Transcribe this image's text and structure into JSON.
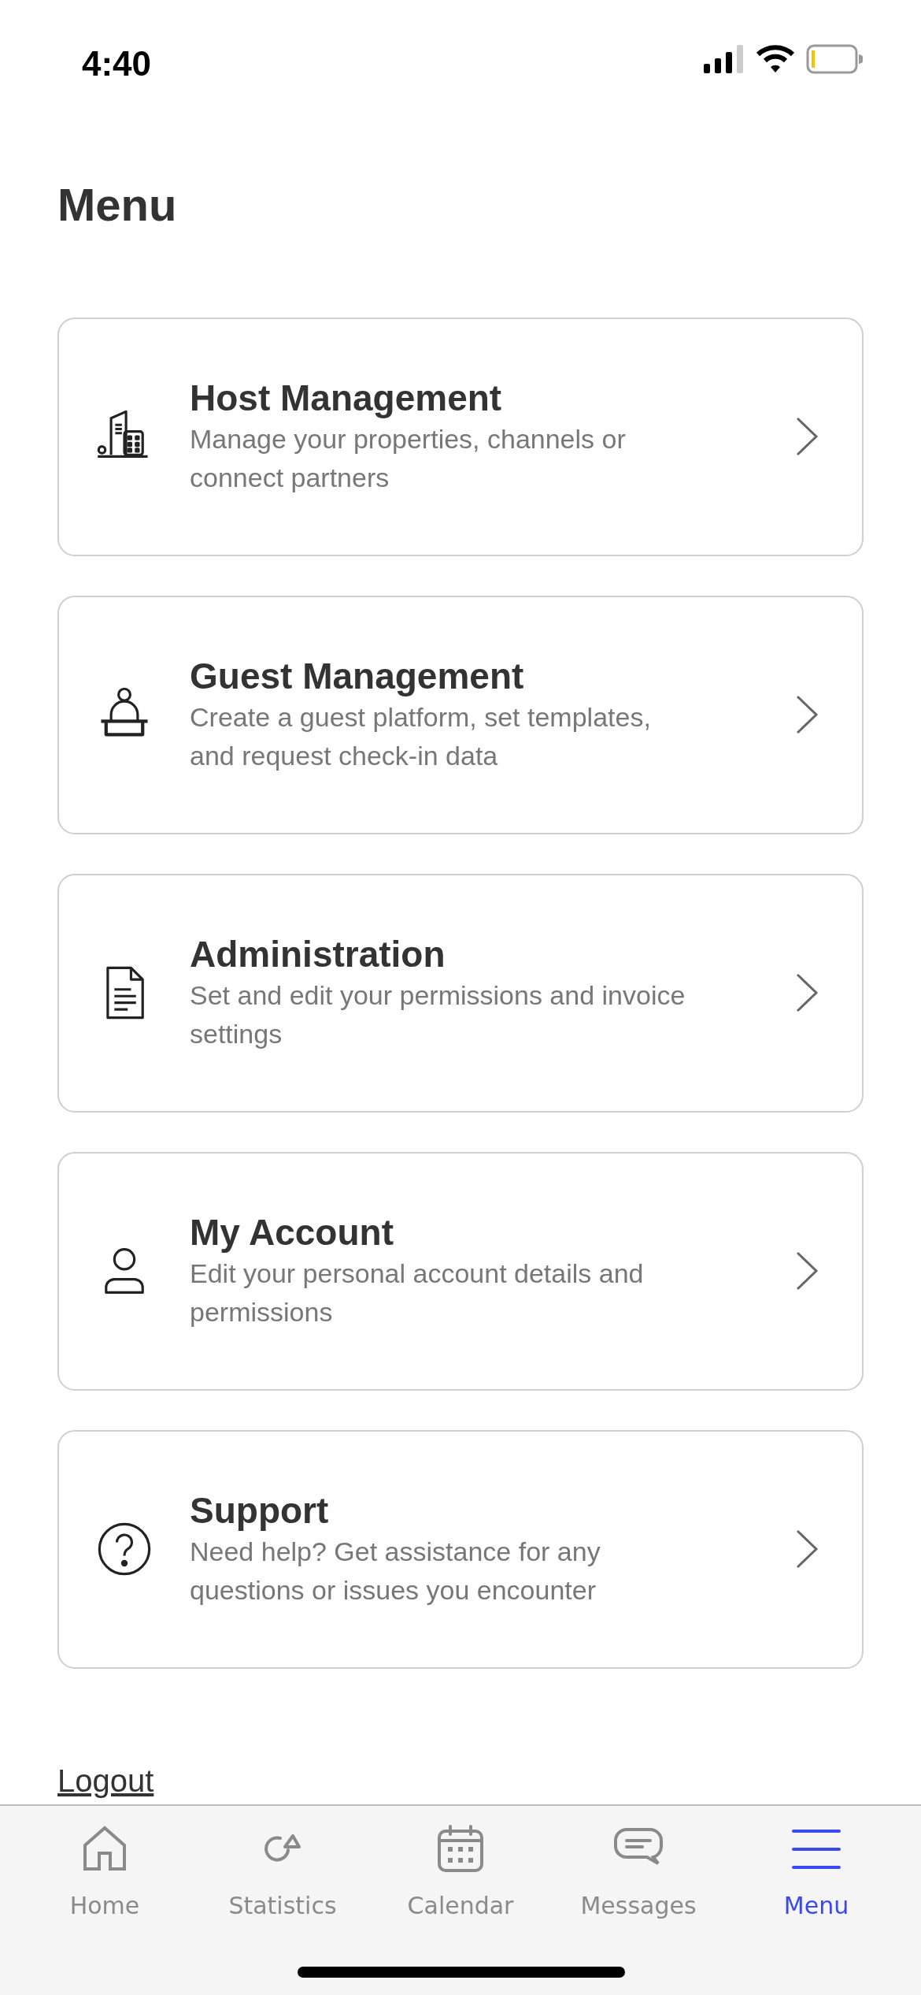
{
  "status_bar": {
    "time": "4:40"
  },
  "title": "Menu",
  "menu_items": [
    {
      "title": "Host Management",
      "description": "Manage your properties, channels or connect partners"
    },
    {
      "title": "Guest Management",
      "description": "Create a guest platform, set templates, and request check-in data"
    },
    {
      "title": "Administration",
      "description": "Set and edit your permissions and invoice settings"
    },
    {
      "title": "My Account",
      "description": "Edit your personal account details and permissions"
    },
    {
      "title": "Support",
      "description": "Need help? Get assistance for any questions or issues you encounter"
    }
  ],
  "logout": "Logout",
  "tab_bar": [
    {
      "label": "Home",
      "selected": false
    },
    {
      "label": "Statistics",
      "selected": false
    },
    {
      "label": "Calendar",
      "selected": false
    },
    {
      "label": "Messages",
      "selected": false
    },
    {
      "label": "Menu",
      "selected": true
    }
  ]
}
